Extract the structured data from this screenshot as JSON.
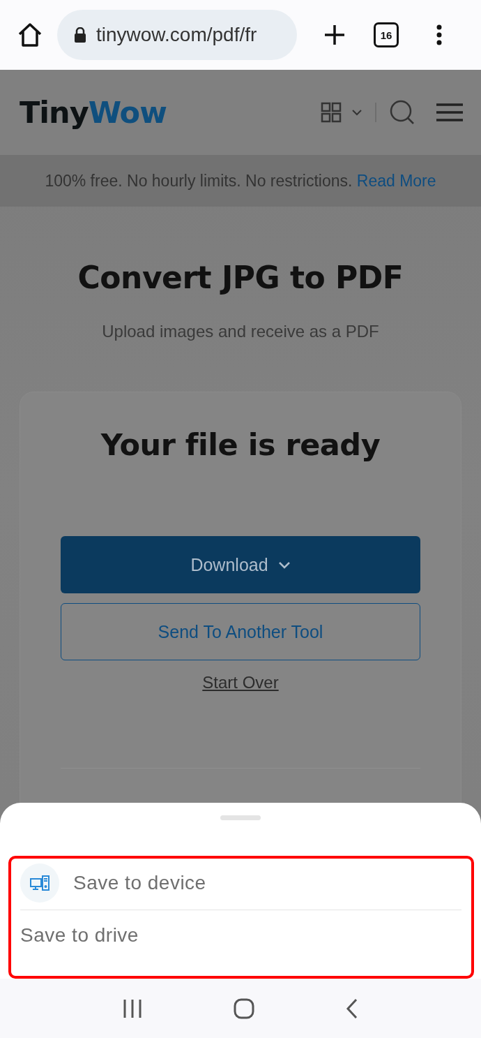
{
  "browser": {
    "url": "tinywow.com/pdf/fr",
    "tab_count": "16"
  },
  "site": {
    "logo": [
      {
        "text": "Tiny",
        "kind": "dark"
      },
      {
        "text": "Wow",
        "kind": "accent"
      }
    ],
    "banner": {
      "text": "100% free. No hourly limits. No restrictions.",
      "link": "Read More"
    },
    "title": "Convert JPG to PDF",
    "subtitle": "Upload images and receive as a PDF",
    "card": {
      "heading": "Your file is ready",
      "buttons": [
        {
          "label": "Download",
          "kind": "primary"
        },
        {
          "label": "Send To Another Tool",
          "kind": "outline"
        }
      ],
      "link": "Start Over"
    }
  },
  "sheet": {
    "highlighted": true,
    "options": [
      {
        "label": "Save to device",
        "kind": "device"
      },
      {
        "label": "Save to drive",
        "kind": "plain"
      }
    ]
  }
}
